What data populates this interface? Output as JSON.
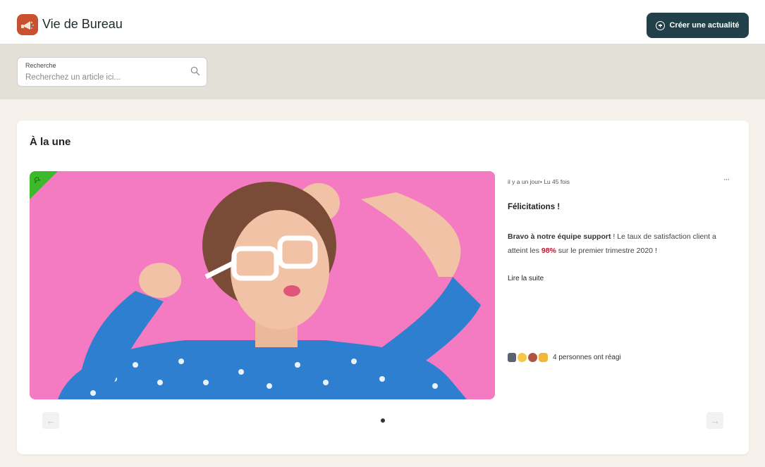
{
  "header": {
    "app_title": "Vie de Bureau",
    "create_button_label": "Créer une actualité",
    "brand_color": "#c9512f",
    "button_color": "#21404a"
  },
  "search": {
    "label": "Recherche",
    "placeholder": "Recherchez un article ici...",
    "value": ""
  },
  "featured": {
    "section_title": "À la une",
    "post": {
      "age": "il y a un jour",
      "reads": "Lu 45 fois",
      "title": "Félicitations !",
      "body_strong": "Bravo à notre équipe support",
      "body_part1": " ! Le taux de satisfaction client a atteint les ",
      "highlight": "98%",
      "body_part2": " sur le premier trimestre 2020 !",
      "read_more": "Lire la suite",
      "reactions_text": "4 personnes ont réagi",
      "reaction_icons": [
        "thumbs-up-icon",
        "laughing-face-icon",
        "heart-icon",
        "clapping-hands-icon"
      ],
      "pinned": true
    },
    "carousel": {
      "current_page": 1,
      "total_pages": 1
    }
  },
  "colors": {
    "background": "#f6f1ea",
    "search_band": "#e3e1d7",
    "highlight_red": "#c8102e",
    "pin_badge_green": "#3cba2b",
    "image_background_pink": "#f47bc2"
  }
}
